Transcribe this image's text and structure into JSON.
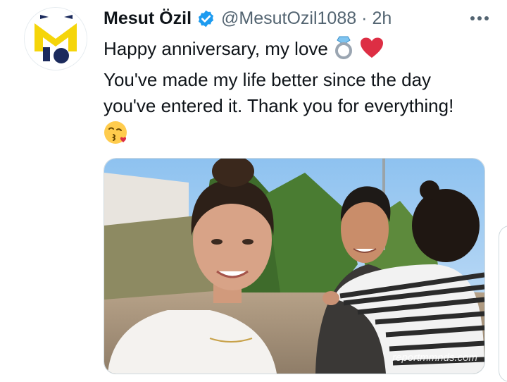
{
  "author": {
    "display_name": "Mesut Özil",
    "handle": "@MesutOzil1088",
    "separator": "·",
    "timestamp": "2h",
    "verified": true
  },
  "tweet": {
    "line1": "Happy anniversary, my love",
    "line2": "You've made my life better since the day",
    "line3": "you've entered it. Thank you for everything!",
    "emojis": [
      "ring-icon",
      "red-heart-icon",
      "kissing-face-icon"
    ]
  },
  "media": {
    "watermark": "reportmmnds.com"
  },
  "colors": {
    "accent": "#1d9bf0",
    "text_primary": "#0f1419",
    "text_secondary": "#536471",
    "logo_yellow": "#f5d50a",
    "logo_navy": "#1b2a5c"
  }
}
